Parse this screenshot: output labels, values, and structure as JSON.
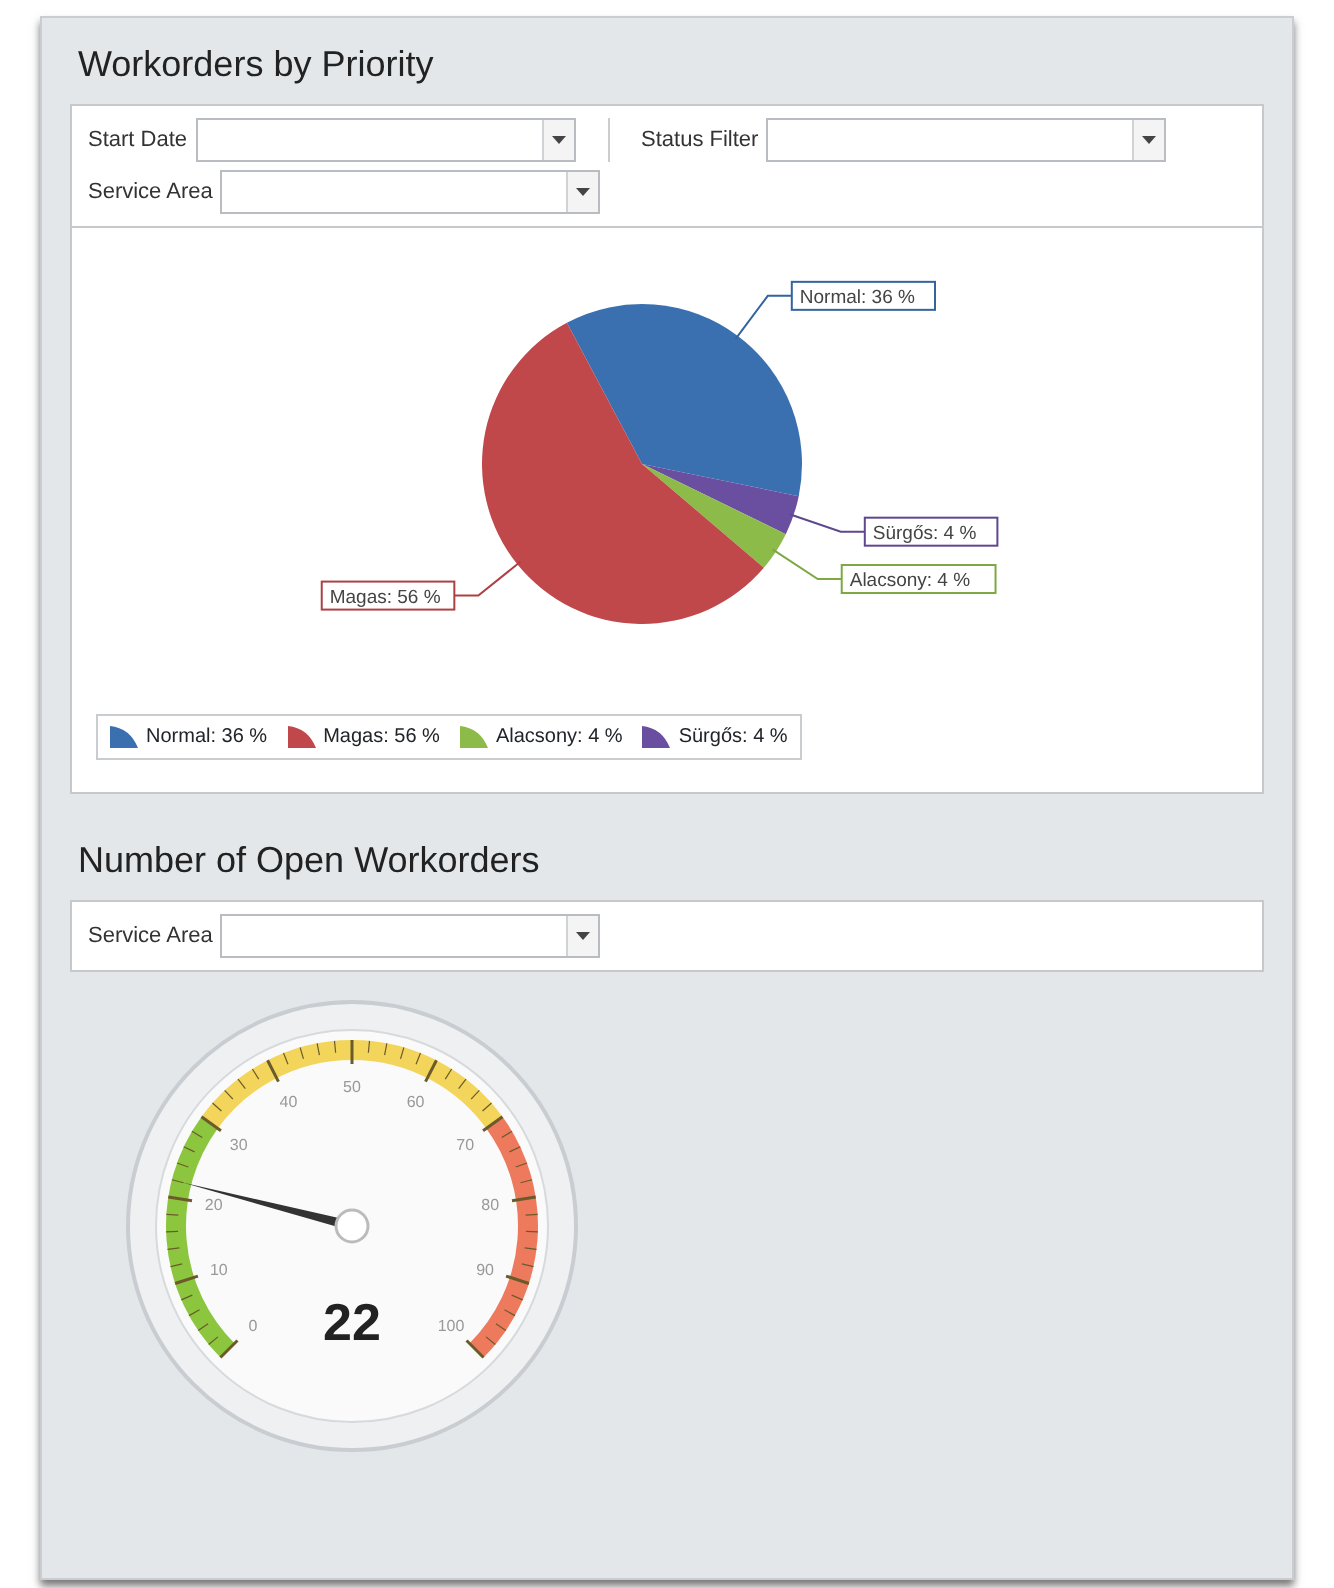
{
  "priority_panel": {
    "title": "Workorders by Priority",
    "filters": [
      {
        "label": "Start Date"
      },
      {
        "label": "Status Filter"
      },
      {
        "label": "Service Area"
      }
    ],
    "chart_data": {
      "type": "pie",
      "values": [
        36,
        56,
        4,
        4
      ],
      "value_labels": [
        "Normal: 36 %",
        "Magas: 56 %",
        "Alacsony: 4 %",
        "Sürgős: 4 %"
      ]
    },
    "legend": [
      {
        "label": "Normal: 36 %",
        "color": "#3a6fb0"
      },
      {
        "label": "Magas: 56 %",
        "color": "#c0474a"
      },
      {
        "label": "Alacsony: 4 %",
        "color": "#8cbb4a"
      },
      {
        "label": "Sürgős: 4 %",
        "color": "#6a4fa0"
      }
    ]
  },
  "open_panel": {
    "title": "Number of Open Workorders",
    "filters": [
      {
        "label": "Service Area"
      }
    ],
    "gauge": {
      "level": 0.22,
      "reading": "22",
      "scale_labels": [
        "0",
        "10",
        "20",
        "30",
        "40",
        "50",
        "60",
        "70",
        "80",
        "90",
        "100"
      ]
    }
  }
}
